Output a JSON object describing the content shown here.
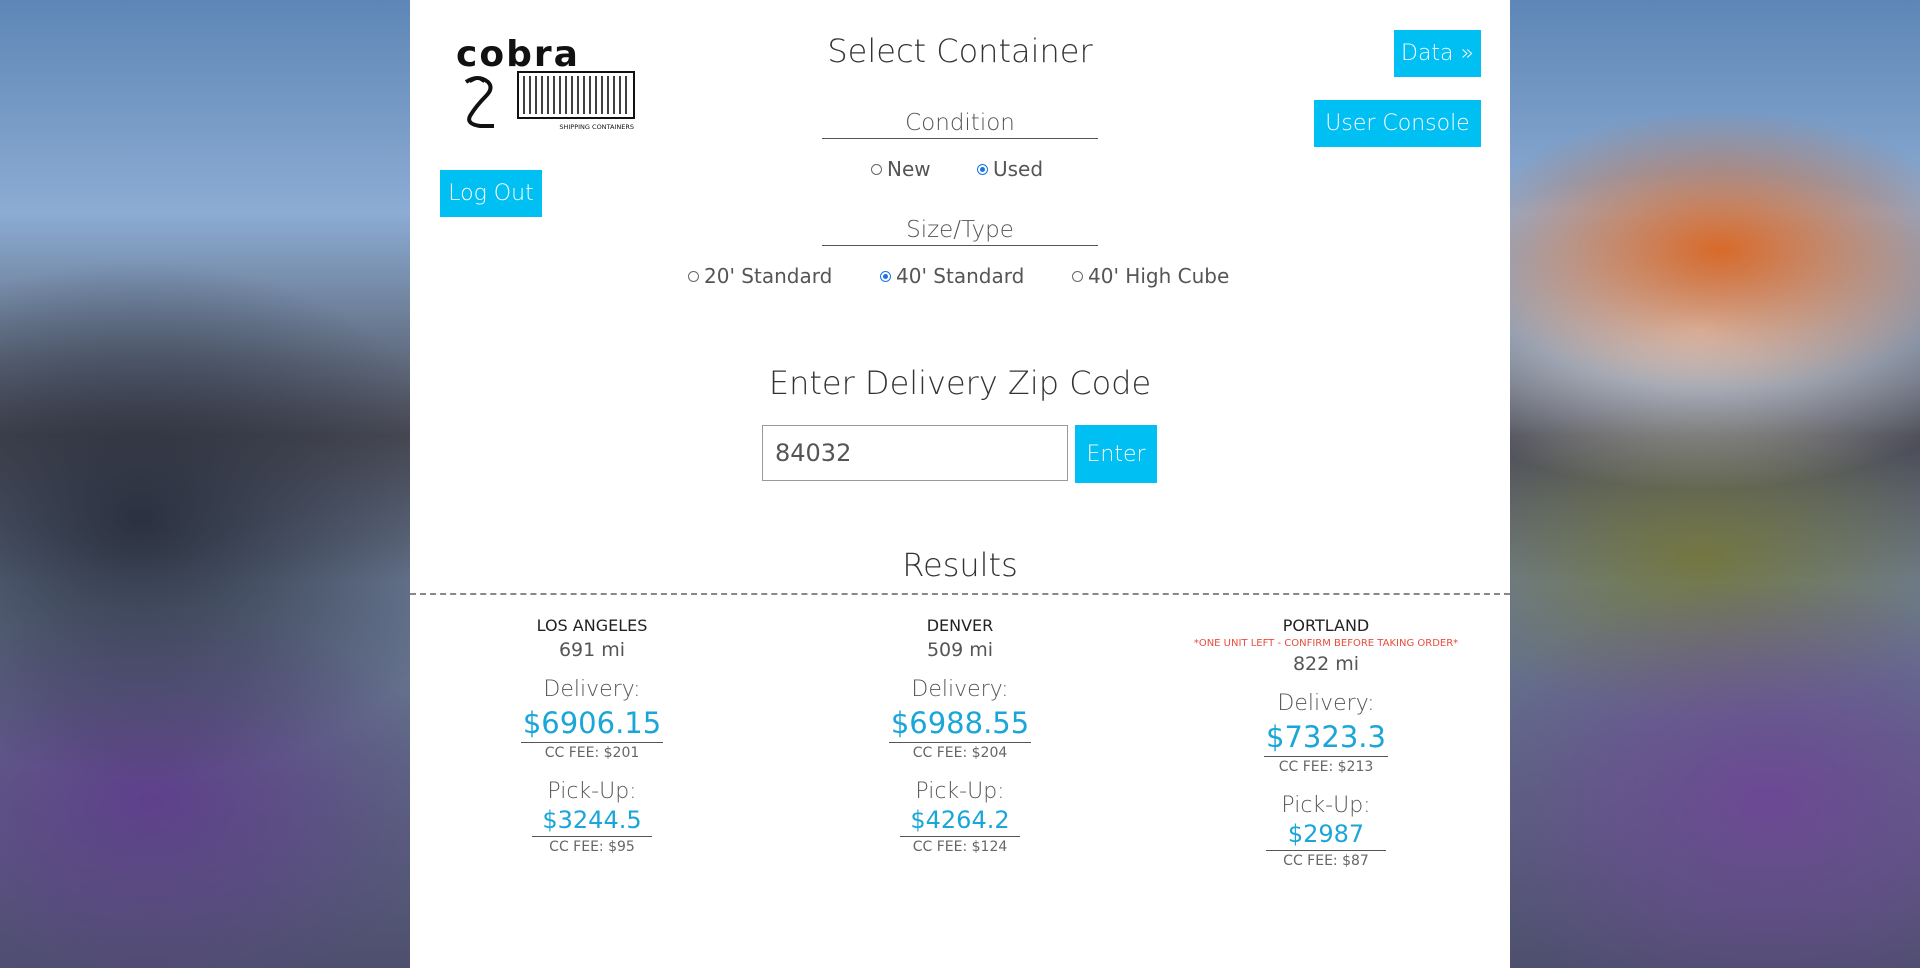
{
  "header": {
    "title": "Select Container",
    "logo_text": "cobra",
    "logo_subtext": "SHIPPING CONTAINERS",
    "data_button": "Data »",
    "user_console_button": "User Console",
    "logout_button": "Log Out"
  },
  "condition": {
    "label": "Condition",
    "options": [
      "New",
      "Used"
    ],
    "selected": "Used"
  },
  "size_type": {
    "label": "Size/Type",
    "options": [
      "20' Standard",
      "40' Standard",
      "40' High Cube"
    ],
    "selected": "40' Standard"
  },
  "zip": {
    "title": "Enter Delivery Zip Code",
    "value": "84032",
    "enter_button": "Enter"
  },
  "results": {
    "title": "Results",
    "locations": [
      {
        "city": "LOS ANGELES",
        "warning": "",
        "miles": "691 mi",
        "delivery_label": "Delivery:",
        "delivery_price": "$6906.15",
        "delivery_fee": "CC FEE: $201",
        "pickup_label": "Pick-Up:",
        "pickup_price": "$3244.5",
        "pickup_fee": "CC FEE: $95"
      },
      {
        "city": "DENVER",
        "warning": "",
        "miles": "509 mi",
        "delivery_label": "Delivery:",
        "delivery_price": "$6988.55",
        "delivery_fee": "CC FEE: $204",
        "pickup_label": "Pick-Up:",
        "pickup_price": "$4264.2",
        "pickup_fee": "CC FEE: $124"
      },
      {
        "city": "PORTLAND",
        "warning": "*ONE UNIT LEFT - CONFIRM BEFORE TAKING ORDER*",
        "miles": "822 mi",
        "delivery_label": "Delivery:",
        "delivery_price": "$7323.3",
        "delivery_fee": "CC FEE: $213",
        "pickup_label": "Pick-Up:",
        "pickup_price": "$2987",
        "pickup_fee": "CC FEE: $87"
      }
    ]
  },
  "colors": {
    "accent": "#00bff3",
    "price": "#1aa6d8",
    "warning": "#e74c3c"
  }
}
